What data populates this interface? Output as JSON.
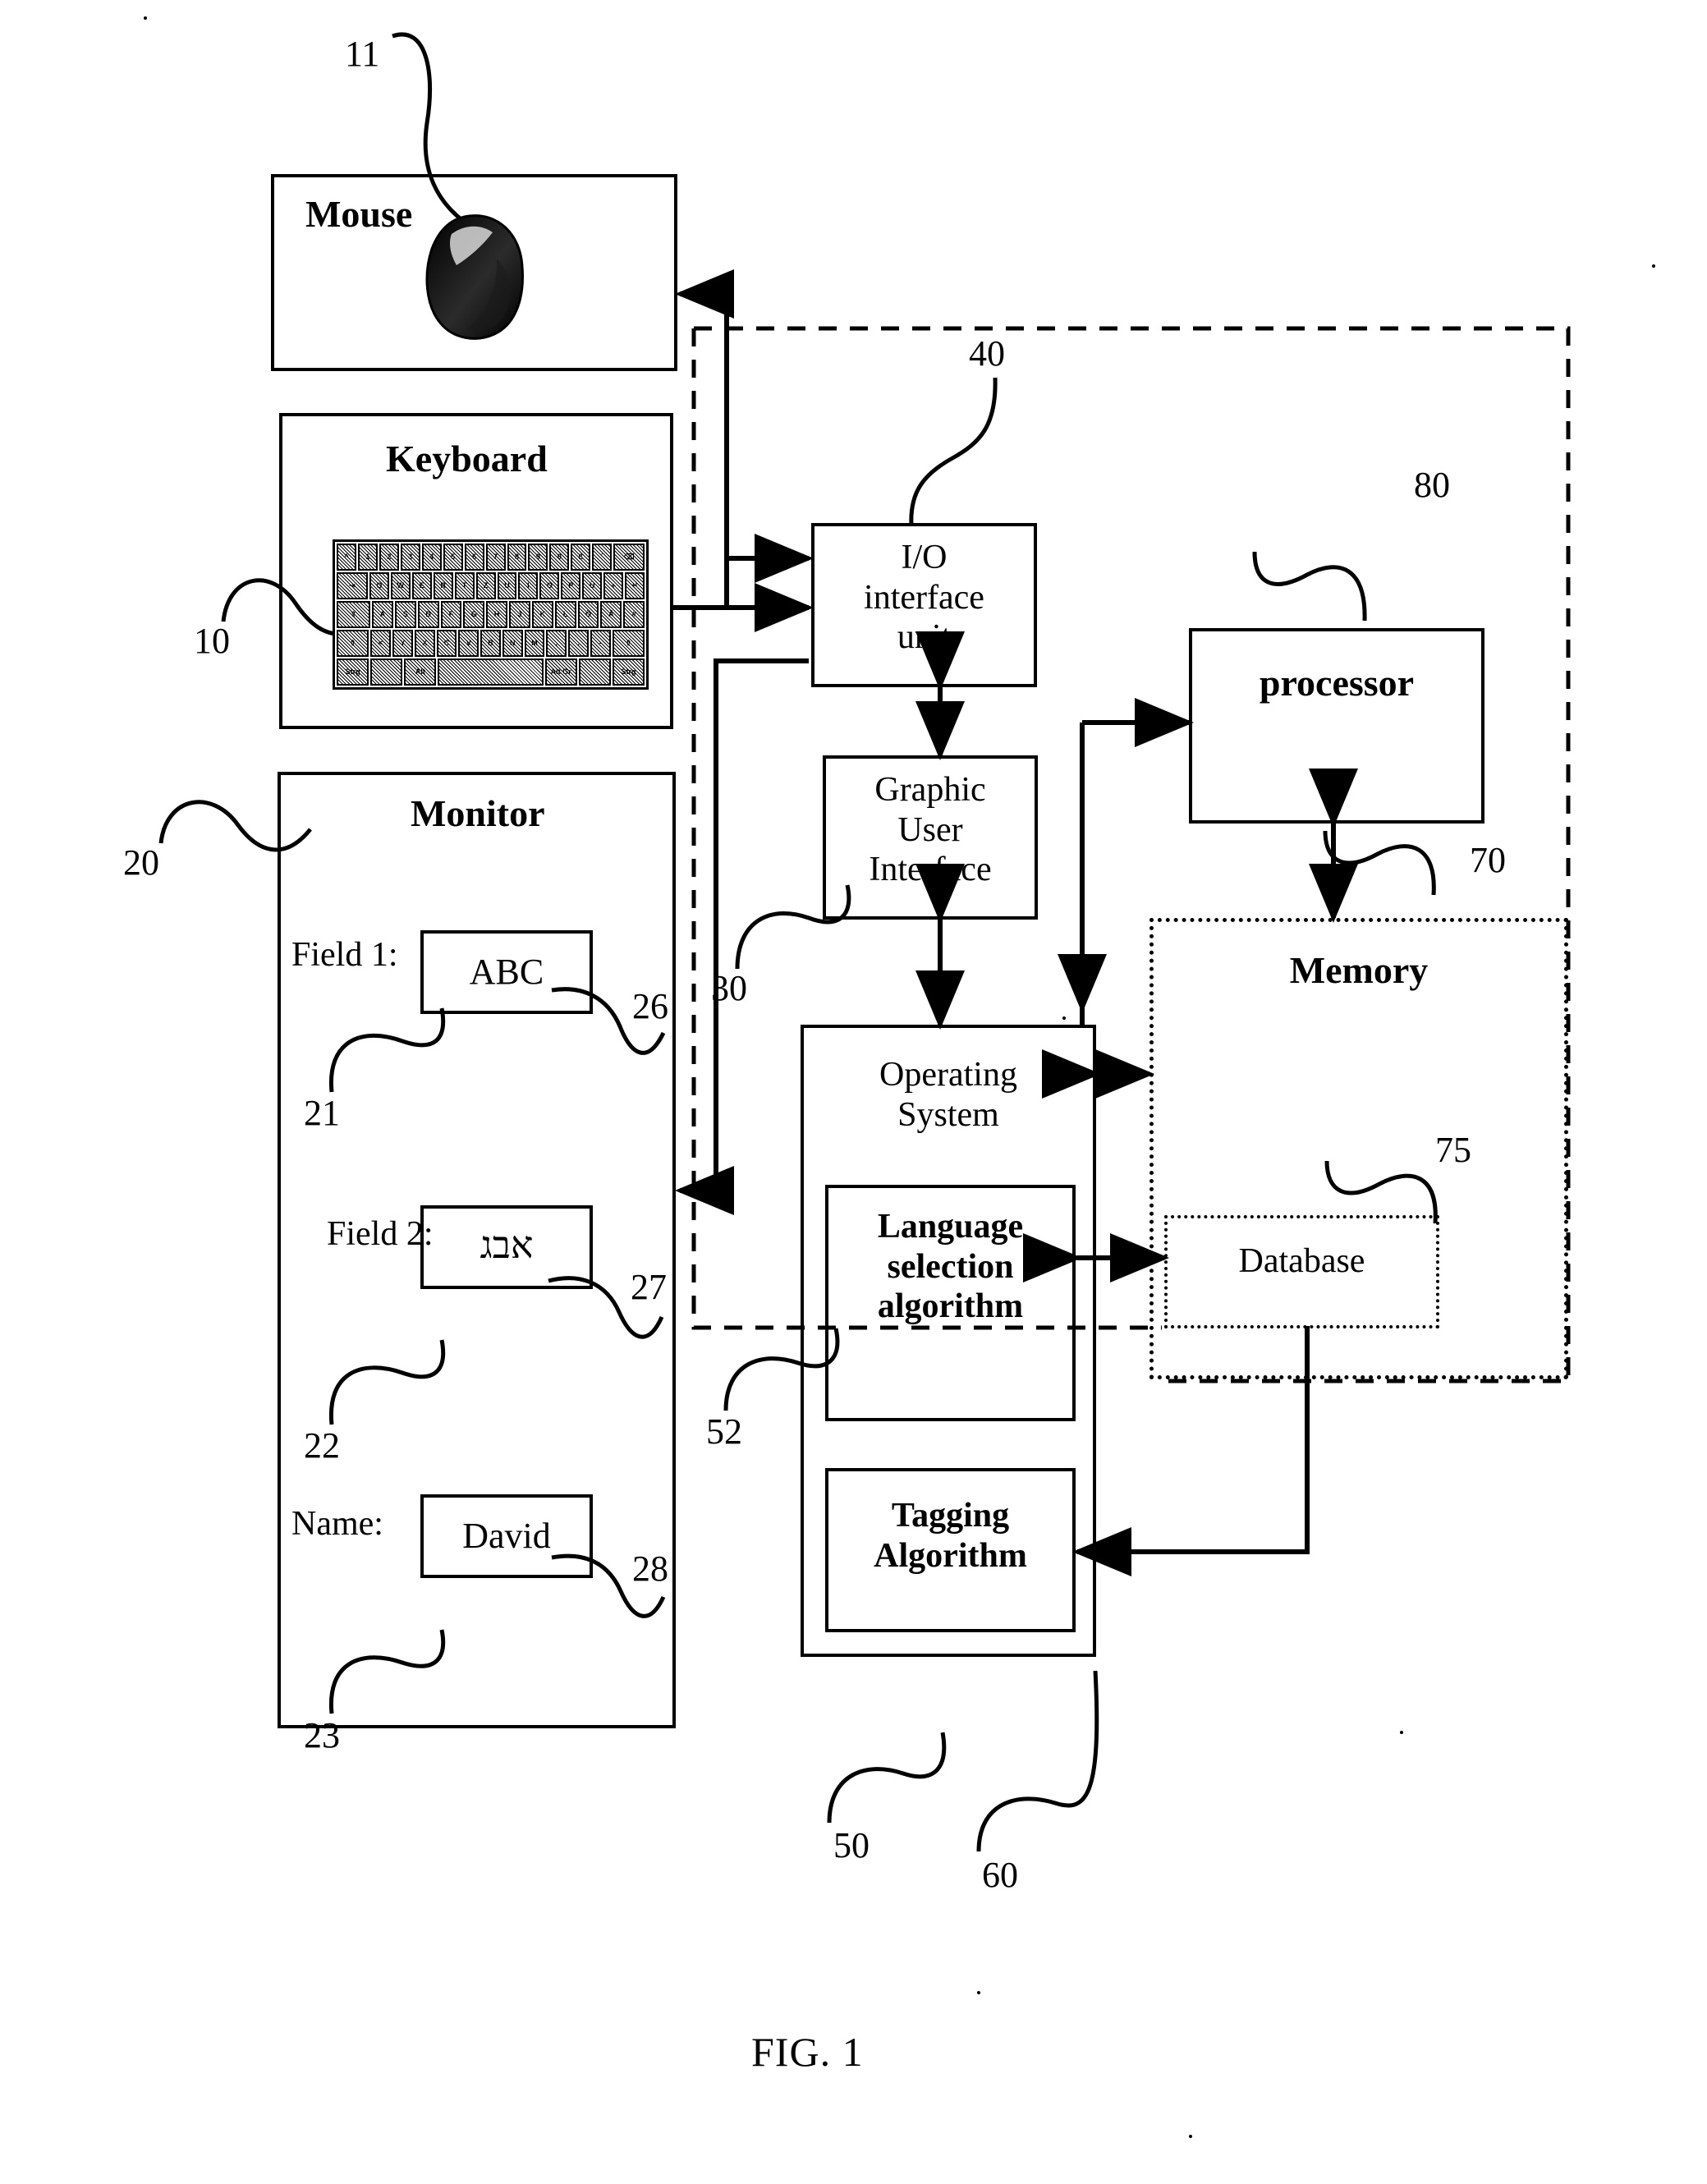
{
  "figure": {
    "caption": "FIG. 1",
    "domain": "patent-block-diagram"
  },
  "blocks": {
    "mouse": {
      "title": "Mouse",
      "ref": "11"
    },
    "keyboard": {
      "title": "Keyboard",
      "ref": "10"
    },
    "monitor": {
      "title": "Monitor",
      "ref": "20"
    },
    "io_interface": {
      "title": "I/O\ninterface\nunit",
      "ref": "40"
    },
    "gui": {
      "title": "Graphic\nUser\nInterface",
      "ref": "30"
    },
    "processor": {
      "title": "processor",
      "ref": "80"
    },
    "memory": {
      "title": "Memory",
      "ref": "70"
    },
    "database": {
      "title": "Database",
      "ref": "75"
    },
    "operating_system": {
      "title": "Operating\nSystem",
      "ref": "50"
    },
    "language_selection": {
      "title": "Language\nselection\nalgorithm",
      "ref": "52"
    },
    "tagging": {
      "title": "Tagging\nAlgorithm",
      "ref": "60"
    }
  },
  "monitor_fields": [
    {
      "label": "Field 1:",
      "value": "ABC",
      "label_ref": "21",
      "value_ref": "26"
    },
    {
      "label": "Field 2:",
      "value": "אבג",
      "label_ref": "22",
      "value_ref": "27"
    },
    {
      "label": "Name:",
      "value": "David",
      "label_ref": "23",
      "value_ref": "28"
    }
  ],
  "keyboard_image": {
    "layout_name": "QWERTZ",
    "rows": [
      [
        "^",
        "1",
        "2",
        "3",
        "4",
        "5",
        "6",
        "7",
        "8",
        "9",
        "0",
        "ß",
        "´",
        "⌫"
      ],
      [
        "↹",
        "Q",
        "W",
        "E",
        "R",
        "T",
        "Z",
        "U",
        "I",
        "O",
        "P",
        "Ü",
        "+",
        "↵"
      ],
      [
        "⇪",
        "A",
        "S",
        "D",
        "F",
        "G",
        "H",
        "J",
        "K",
        "L",
        "Ö",
        "Ä",
        "#"
      ],
      [
        "⇧",
        "<",
        "Y",
        "X",
        "C",
        "V",
        "B",
        "N",
        "M",
        ",",
        ".",
        "-",
        "⇧"
      ],
      [
        "Strg",
        "",
        "Alt",
        "",
        "Alt Gr",
        "",
        "Strg"
      ]
    ]
  },
  "reference_numerals": [
    "11",
    "10",
    "20",
    "21",
    "22",
    "23",
    "26",
    "27",
    "28",
    "30",
    "40",
    "50",
    "52",
    "60",
    "70",
    "75",
    "80"
  ],
  "colors": {
    "ink": "#000000",
    "paper": "#ffffff"
  }
}
